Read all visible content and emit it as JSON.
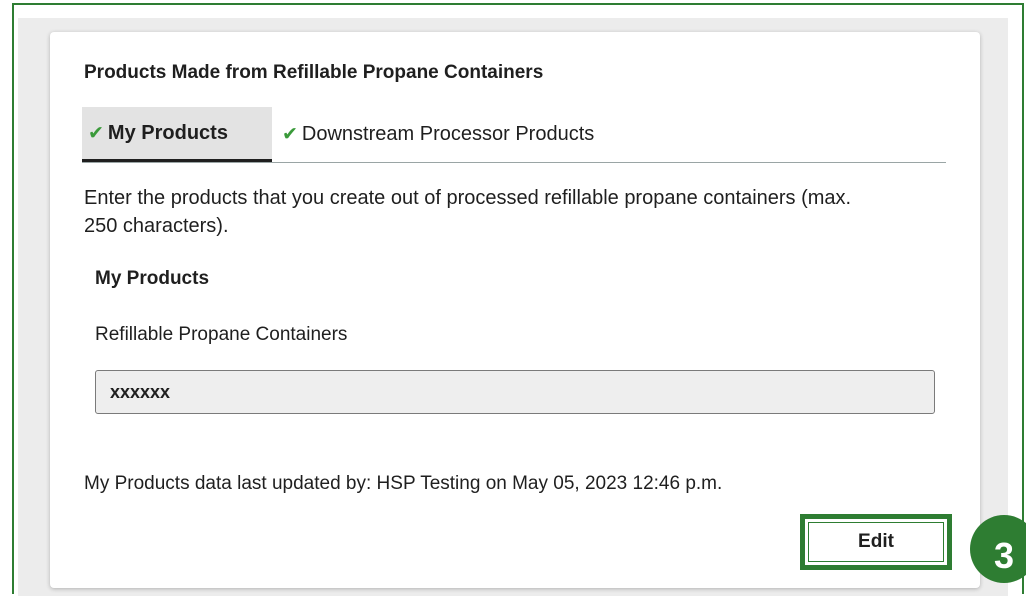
{
  "card": {
    "title": "Products Made from Refillable Propane Containers"
  },
  "tabs": [
    {
      "label": "My Products",
      "icon": "check-icon",
      "active": true
    },
    {
      "label": "Downstream Processor Products",
      "icon": "check-icon",
      "active": false
    }
  ],
  "instructions": "Enter the products that you create out of processed refillable propane containers (max. 250 characters).",
  "section": {
    "heading": "My Products",
    "field_label": "Refillable Propane Containers",
    "field_value": "xxxxxx"
  },
  "last_updated": "My Products data last updated by: HSP Testing on  May 05, 2023 12:46 p.m.",
  "edit_label": "Edit",
  "step_number": "3",
  "colors": {
    "accent_green": "#2e7d32",
    "check_green": "#3a9a3a",
    "panel_background": "#ececec"
  }
}
